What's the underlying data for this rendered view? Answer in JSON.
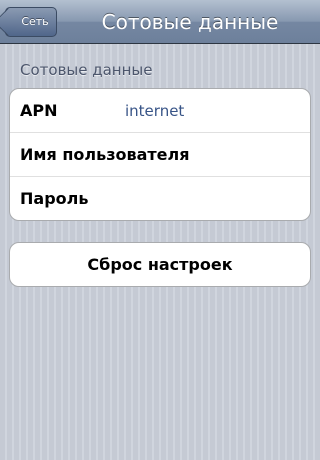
{
  "navbar": {
    "back_label": "Сеть",
    "title": "Сотовые данные"
  },
  "section": {
    "header": "Сотовые данные"
  },
  "fields": [
    {
      "label": "APN",
      "value": "internet"
    },
    {
      "label": "Имя пользователя",
      "value": ""
    },
    {
      "label": "Пароль",
      "value": ""
    }
  ],
  "reset": {
    "label": "Сброс настроек"
  }
}
